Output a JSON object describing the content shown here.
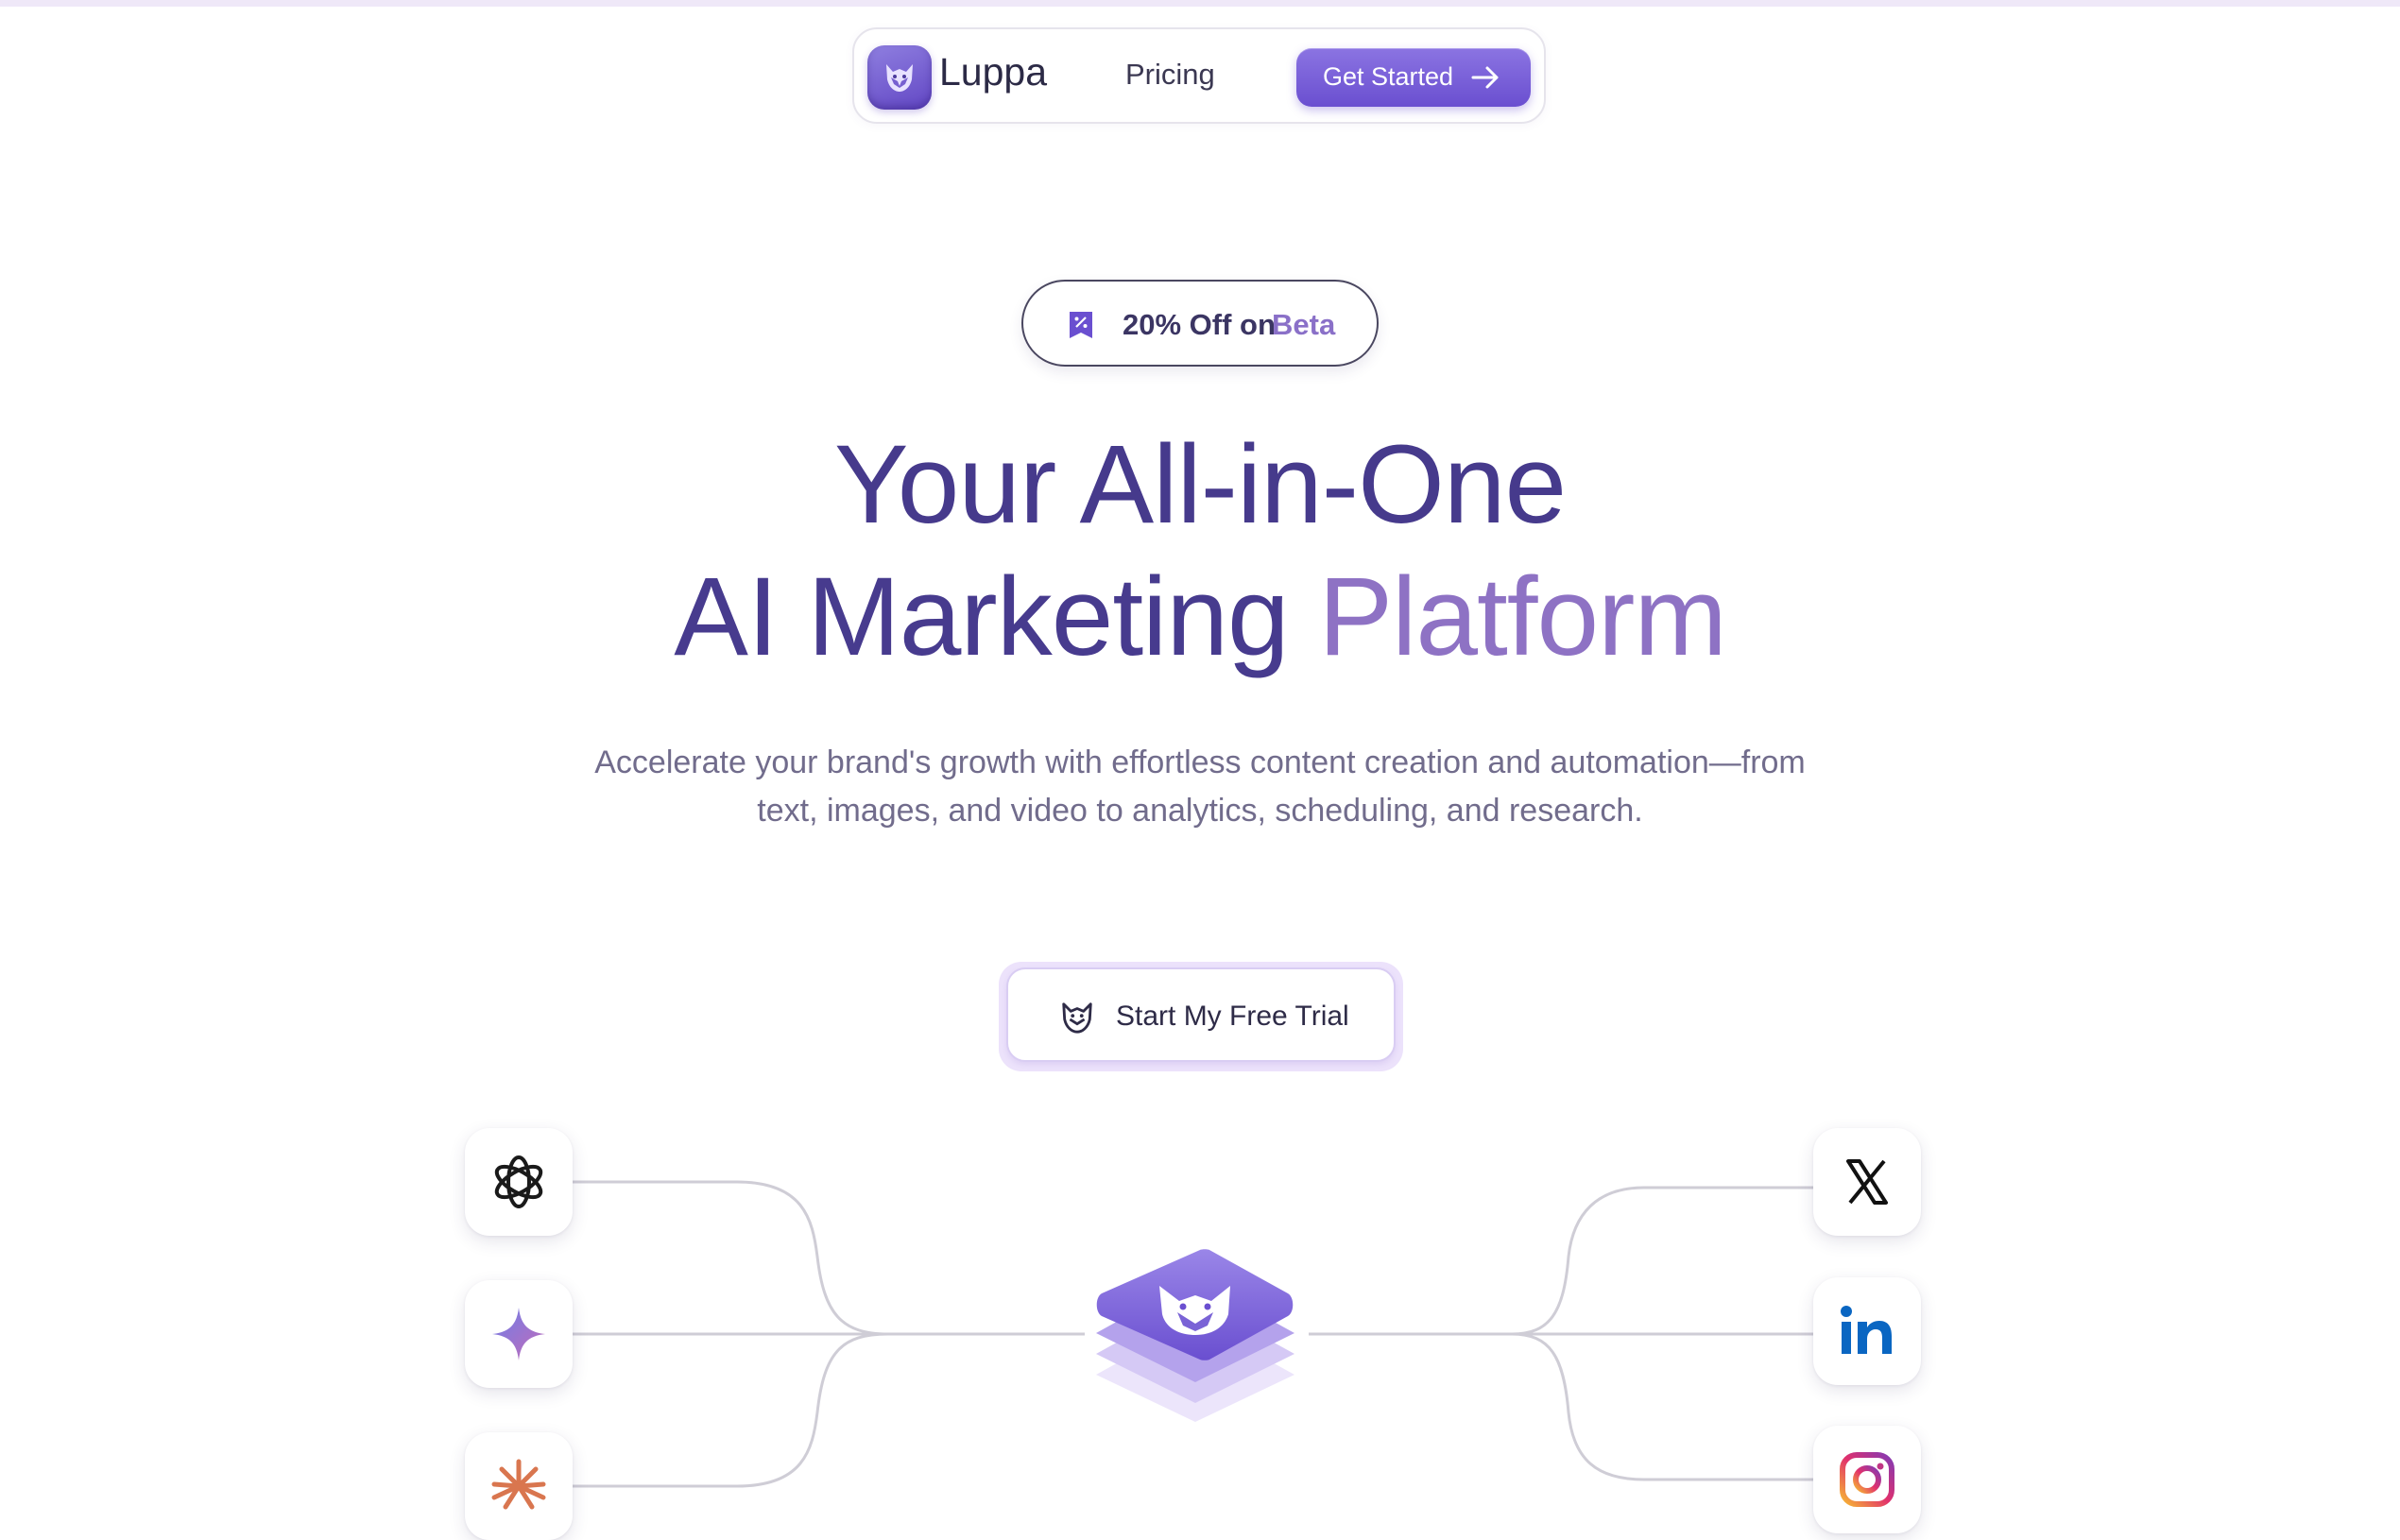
{
  "nav": {
    "brand": "Luppa",
    "pricing_label": "Pricing",
    "cta_label": "Get Started"
  },
  "badge": {
    "text_main": "20% Off on",
    "text_accent": "Beta"
  },
  "hero": {
    "line1": "Your All-in-One",
    "line2_part1": "AI Marketing",
    "line2_part2": "Platform",
    "subtitle": "Accelerate your brand's growth with effortless content creation and automation—from text, images, and video to analytics, scheduling, and research."
  },
  "cta": {
    "trial_label": "Start My Free Trial"
  },
  "integrations": {
    "left": [
      "openai-icon",
      "gemini-sparkle-icon",
      "claude-icon"
    ],
    "right": [
      "x-icon",
      "linkedin-icon",
      "instagram-icon"
    ],
    "hub": "luppa-hub-icon"
  },
  "colors": {
    "accent": "#6a4fd0",
    "heading": "#463a8c",
    "heading_gradient_end": "#8e72c4",
    "body_text": "#716c8c"
  }
}
